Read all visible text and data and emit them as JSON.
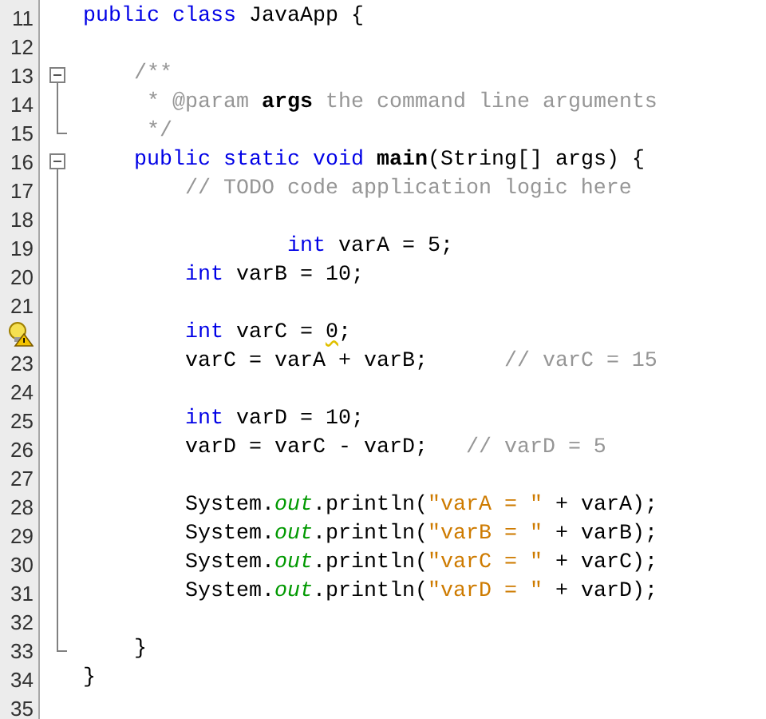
{
  "editor": {
    "lines": [
      {
        "number": "11",
        "kind": "plain",
        "tokens": [
          {
            "kind": "keyword",
            "text": "public class "
          },
          {
            "kind": "plain",
            "text": "JavaApp {"
          }
        ]
      },
      {
        "number": "12",
        "kind": "plain"
      },
      {
        "number": "13",
        "kind": "fold-start",
        "tokens": [
          {
            "kind": "comment",
            "text": "    /**"
          }
        ]
      },
      {
        "number": "14",
        "kind": "folded",
        "tokens": [
          {
            "kind": "comment",
            "text": "     * @param "
          },
          {
            "kind": "doc-param",
            "text": "args"
          },
          {
            "kind": "comment",
            "text": " the command line arguments"
          }
        ]
      },
      {
        "number": "15",
        "kind": "fold-end",
        "tokens": [
          {
            "kind": "comment",
            "text": "     */"
          }
        ]
      },
      {
        "number": "16",
        "kind": "fold-start",
        "tokens": [
          {
            "kind": "keyword",
            "text": "    public static void "
          },
          {
            "kind": "method",
            "text": "main"
          },
          {
            "kind": "plain",
            "text": "(String[] args) {"
          }
        ]
      },
      {
        "number": "17",
        "kind": "folded",
        "tokens": [
          {
            "kind": "comment",
            "text": "        // TODO code application logic here"
          }
        ]
      },
      {
        "number": "18",
        "kind": "folded"
      },
      {
        "number": "19",
        "kind": "folded",
        "tokens": [
          {
            "kind": "keyword",
            "text": "                int "
          },
          {
            "kind": "plain",
            "text": "varA = 5;"
          }
        ]
      },
      {
        "number": "20",
        "kind": "folded",
        "tokens": [
          {
            "kind": "keyword",
            "text": "        int "
          },
          {
            "kind": "plain",
            "text": "varB = 10;"
          }
        ]
      },
      {
        "number": "21",
        "kind": "folded"
      },
      {
        "warning": true,
        "kind": "folded",
        "tokens": [
          {
            "kind": "keyword",
            "text": "        int "
          },
          {
            "kind": "plain",
            "text": "varC = "
          },
          {
            "kind": "flagged",
            "text": "0"
          },
          {
            "kind": "plain",
            "text": ";"
          }
        ]
      },
      {
        "number": "23",
        "kind": "folded",
        "tokens": [
          {
            "kind": "plain",
            "text": "        varC = varA + varB;      "
          },
          {
            "kind": "comment",
            "text": "// varC = 15"
          }
        ]
      },
      {
        "number": "24",
        "kind": "folded"
      },
      {
        "number": "25",
        "kind": "folded",
        "tokens": [
          {
            "kind": "keyword",
            "text": "        int "
          },
          {
            "kind": "plain",
            "text": "varD = 10;"
          }
        ]
      },
      {
        "number": "26",
        "kind": "folded",
        "tokens": [
          {
            "kind": "plain",
            "text": "        varD = varC - varD;   "
          },
          {
            "kind": "comment",
            "text": "// varD = 5"
          }
        ]
      },
      {
        "number": "27",
        "kind": "folded"
      },
      {
        "number": "28",
        "kind": "folded",
        "tokens": [
          {
            "kind": "plain",
            "text": "        System."
          },
          {
            "kind": "field",
            "text": "out"
          },
          {
            "kind": "plain",
            "text": ".println("
          },
          {
            "kind": "string",
            "text": "\"varA = \""
          },
          {
            "kind": "plain",
            "text": " + varA);"
          }
        ]
      },
      {
        "number": "29",
        "kind": "folded",
        "tokens": [
          {
            "kind": "plain",
            "text": "        System."
          },
          {
            "kind": "field",
            "text": "out"
          },
          {
            "kind": "plain",
            "text": ".println("
          },
          {
            "kind": "string",
            "text": "\"varB = \""
          },
          {
            "kind": "plain",
            "text": " + varB);"
          }
        ]
      },
      {
        "number": "30",
        "kind": "folded",
        "tokens": [
          {
            "kind": "plain",
            "text": "        System."
          },
          {
            "kind": "field",
            "text": "out"
          },
          {
            "kind": "plain",
            "text": ".println("
          },
          {
            "kind": "string",
            "text": "\"varC = \""
          },
          {
            "kind": "plain",
            "text": " + varC);"
          }
        ]
      },
      {
        "number": "31",
        "kind": "folded",
        "tokens": [
          {
            "kind": "plain",
            "text": "        System."
          },
          {
            "kind": "field",
            "text": "out"
          },
          {
            "kind": "plain",
            "text": ".println("
          },
          {
            "kind": "string",
            "text": "\"varD = \""
          },
          {
            "kind": "plain",
            "text": " + varD);"
          }
        ]
      },
      {
        "number": "32",
        "kind": "folded"
      },
      {
        "number": "33",
        "kind": "fold-end",
        "tokens": [
          {
            "kind": "plain",
            "text": "    }"
          }
        ]
      },
      {
        "number": "34",
        "kind": "plain",
        "tokens": [
          {
            "kind": "plain",
            "text": "}"
          }
        ]
      },
      {
        "number": "35",
        "kind": "plain"
      }
    ]
  }
}
